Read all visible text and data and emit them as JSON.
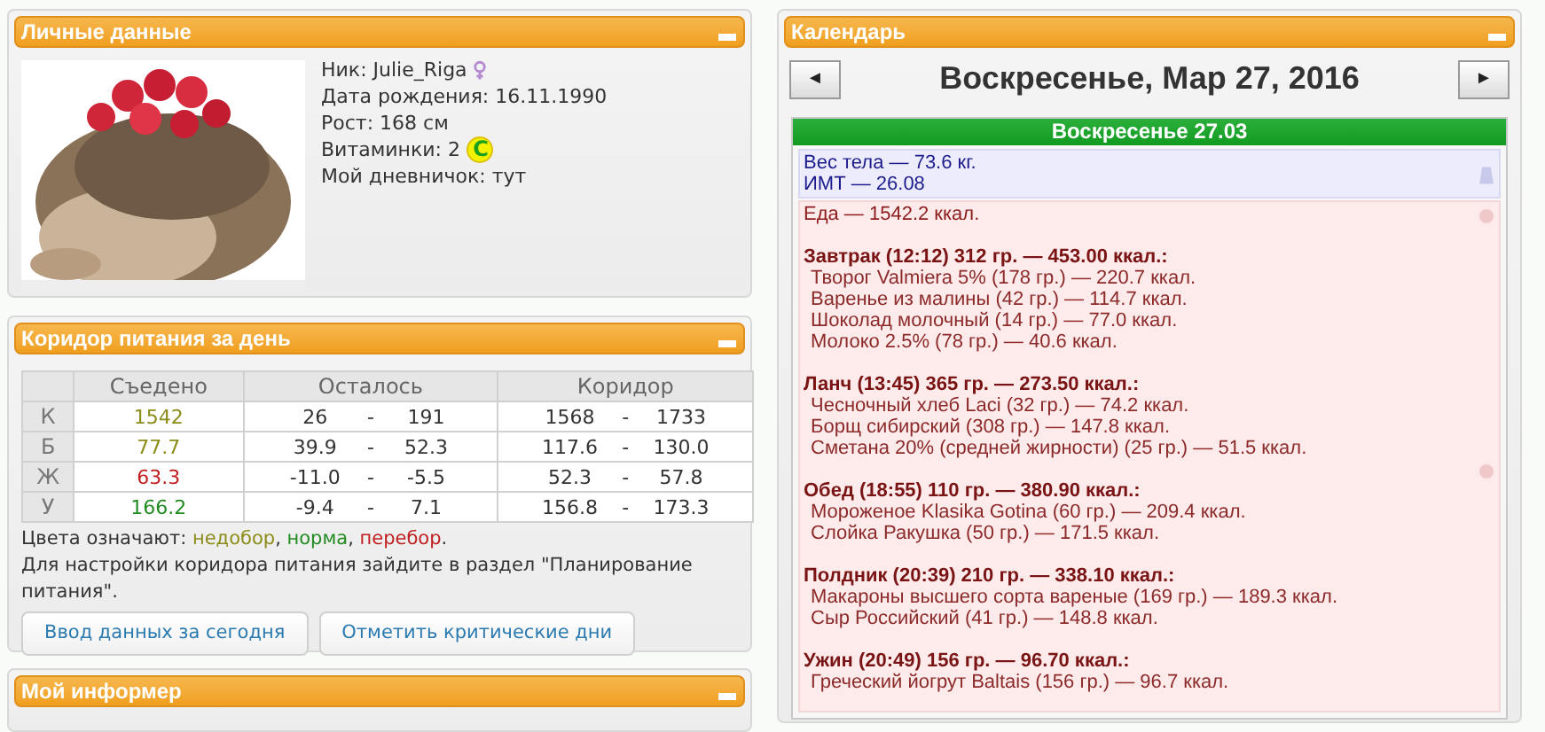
{
  "profile": {
    "title": "Личные данные",
    "fields": [
      {
        "label": "Ник:",
        "value": "Julie_Riga",
        "kind": "gender"
      },
      {
        "label": "Дата рождения:",
        "value": "16.11.1990",
        "kind": "plain"
      },
      {
        "label": "Рост:",
        "value": "168 см",
        "kind": "plain"
      },
      {
        "label": "Витаминки:",
        "value": "2",
        "kind": "vitamin",
        "badge": "C"
      },
      {
        "label": "Мой дневничок:",
        "value": "тут",
        "kind": "plain"
      }
    ]
  },
  "corridor": {
    "title": "Коридор питания за день",
    "columns": [
      "Съедено",
      "Осталось",
      "Коридор"
    ],
    "rows": [
      {
        "nutrient": "К",
        "eaten": "1542",
        "color": "#8c8c1a",
        "left_min": "26",
        "left_max": "191",
        "corr_min": "1568",
        "corr_max": "1733"
      },
      {
        "nutrient": "Б",
        "eaten": "77.7",
        "color": "#8c8c1a",
        "left_min": "39.9",
        "left_max": "52.3",
        "corr_min": "117.6",
        "corr_max": "130.0"
      },
      {
        "nutrient": "Ж",
        "eaten": "63.3",
        "color": "#c02020",
        "left_min": "-11.0",
        "left_max": "-5.5",
        "corr_min": "52.3",
        "corr_max": "57.8"
      },
      {
        "nutrient": "У",
        "eaten": "166.2",
        "color": "#218a21",
        "left_min": "-9.4",
        "left_max": "7.1",
        "corr_min": "156.8",
        "corr_max": "173.3"
      }
    ],
    "range_separator": "-",
    "legend_label": "Цвета означают:",
    "legend": [
      {
        "text": "недобор",
        "color": "#8c8c1a",
        "after": ","
      },
      {
        "text": "норма",
        "color": "#218a21",
        "after": ","
      },
      {
        "text": "перебор",
        "color": "#c02020",
        "after": "."
      }
    ],
    "note": "Для настройки коридора питания зайдите в раздел \"Планирование питания\".",
    "buttons": [
      "Ввод данных за сегодня",
      "Отметить критические дни"
    ]
  },
  "informer": {
    "title": "Мой информер"
  },
  "calendar": {
    "title": "Календарь",
    "prev": "◄",
    "next": "►",
    "date": "Воскресенье, Мар 27, 2016",
    "day_bar": "Воскресенье 27.03",
    "weight": [
      "Вес тела — 73.6 кг.",
      "ИМТ — 26.08"
    ],
    "food_total": "Еда — 1542.2 ккал.",
    "meals": [
      {
        "title": "Завтрак (12:12) 312 гр. — 453.00 ккал.:",
        "items": [
          "Творог Valmiera 5% (178 гр.) — 220.7 ккал.",
          "Варенье из малины (42 гр.) — 114.7 ккал.",
          "Шоколад молочный (14 гр.) — 77.0 ккал.",
          "Молоко 2.5% (78 гр.) — 40.6 ккал."
        ]
      },
      {
        "title": "Ланч (13:45) 365 гр. — 273.50 ккал.:",
        "items": [
          "Чесночный хлеб Laci (32 гр.) — 74.2 ккал.",
          "Борщ сибирский (308 гр.) — 147.8 ккал.",
          "Сметана 20% (средней жирности) (25 гр.) — 51.5 ккал."
        ]
      },
      {
        "title": "Обед (18:55) 110 гр. — 380.90 ккал.:",
        "items": [
          "Мороженое Klasika Gotina (60 гр.) — 209.4 ккал.",
          "Слойка Ракушка (50 гр.) — 171.5 ккал."
        ]
      },
      {
        "title": "Полдник (20:39) 210 гр. — 338.10 ккал.:",
        "items": [
          "Макароны высшего сорта вареные (169 гр.) — 189.3 ккал.",
          "Сыр Российский (41 гр.) — 148.8 ккал."
        ]
      },
      {
        "title": "Ужин (20:49) 156 гр. — 96.70 ккал.:",
        "items": [
          "Греческий йогрут Baltais (156 гр.) — 96.7 ккал."
        ]
      }
    ]
  }
}
